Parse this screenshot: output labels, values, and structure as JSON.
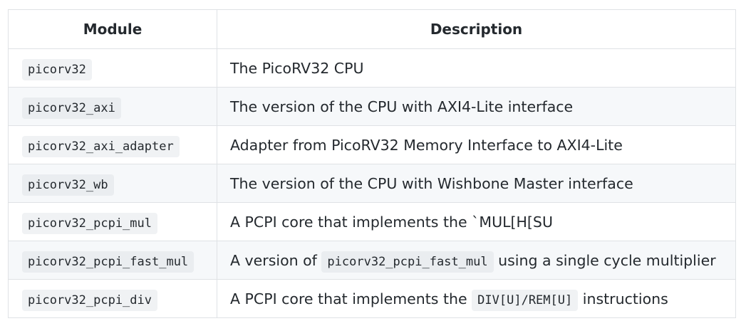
{
  "table": {
    "headers": [
      "Module",
      "Description"
    ],
    "rows": [
      {
        "module": "picorv32",
        "description": [
          {
            "text": "The PicoRV32 CPU"
          }
        ]
      },
      {
        "module": "picorv32_axi",
        "description": [
          {
            "text": "The version of the CPU with AXI4-Lite interface"
          }
        ]
      },
      {
        "module": "picorv32_axi_adapter",
        "description": [
          {
            "text": "Adapter from PicoRV32 Memory Interface to AXI4-Lite"
          }
        ]
      },
      {
        "module": "picorv32_wb",
        "description": [
          {
            "text": "The version of the CPU with Wishbone Master interface"
          }
        ]
      },
      {
        "module": "picorv32_pcpi_mul",
        "description": [
          {
            "text": "A PCPI core that implements the `MUL[H[SU"
          }
        ]
      },
      {
        "module": "picorv32_pcpi_fast_mul",
        "description": [
          {
            "text": "A version of "
          },
          {
            "code": "picorv32_pcpi_fast_mul"
          },
          {
            "text": " using a single cycle multiplier"
          }
        ]
      },
      {
        "module": "picorv32_pcpi_div",
        "description": [
          {
            "text": "A PCPI core that implements the "
          },
          {
            "code": "DIV[U]/REM[U]"
          },
          {
            "text": " instructions"
          }
        ]
      }
    ]
  }
}
